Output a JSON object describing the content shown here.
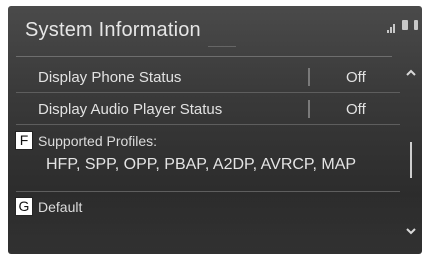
{
  "header": {
    "title": "System Information"
  },
  "status_bar": {
    "icons": [
      "signal-icon",
      "phone-icon",
      "bluetooth-icon"
    ]
  },
  "rows": [
    {
      "label": "Display Phone Status",
      "value": "Off"
    },
    {
      "label": "Display Audio Player Status",
      "value": "Off"
    }
  ],
  "profiles": {
    "callout": "F",
    "heading": "Supported Profiles:",
    "list": "HFP, SPP, OPP, PBAP, A2DP, AVRCP, MAP"
  },
  "default": {
    "callout": "G",
    "label": "Default"
  },
  "scroll": {
    "up_icon": "chevron-up-icon",
    "down_icon": "chevron-down-icon"
  }
}
